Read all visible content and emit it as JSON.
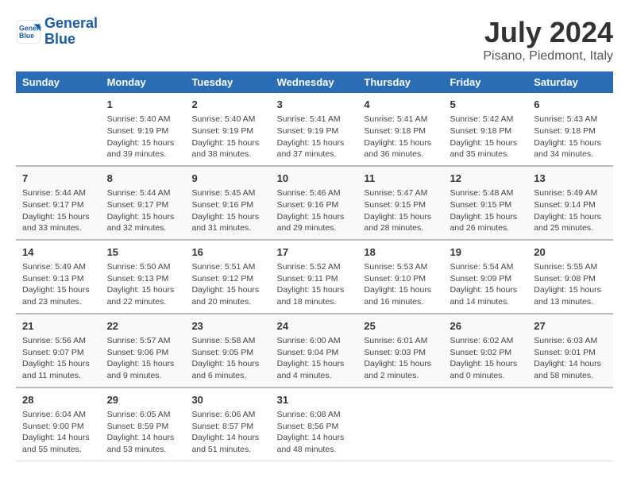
{
  "header": {
    "logo_line1": "General",
    "logo_line2": "Blue",
    "month_year": "July 2024",
    "location": "Pisano, Piedmont, Italy"
  },
  "columns": [
    "Sunday",
    "Monday",
    "Tuesday",
    "Wednesday",
    "Thursday",
    "Friday",
    "Saturday"
  ],
  "weeks": [
    [
      {
        "day": "",
        "info": ""
      },
      {
        "day": "1",
        "info": "Sunrise: 5:40 AM\nSunset: 9:19 PM\nDaylight: 15 hours\nand 39 minutes."
      },
      {
        "day": "2",
        "info": "Sunrise: 5:40 AM\nSunset: 9:19 PM\nDaylight: 15 hours\nand 38 minutes."
      },
      {
        "day": "3",
        "info": "Sunrise: 5:41 AM\nSunset: 9:19 PM\nDaylight: 15 hours\nand 37 minutes."
      },
      {
        "day": "4",
        "info": "Sunrise: 5:41 AM\nSunset: 9:18 PM\nDaylight: 15 hours\nand 36 minutes."
      },
      {
        "day": "5",
        "info": "Sunrise: 5:42 AM\nSunset: 9:18 PM\nDaylight: 15 hours\nand 35 minutes."
      },
      {
        "day": "6",
        "info": "Sunrise: 5:43 AM\nSunset: 9:18 PM\nDaylight: 15 hours\nand 34 minutes."
      }
    ],
    [
      {
        "day": "7",
        "info": "Sunrise: 5:44 AM\nSunset: 9:17 PM\nDaylight: 15 hours\nand 33 minutes."
      },
      {
        "day": "8",
        "info": "Sunrise: 5:44 AM\nSunset: 9:17 PM\nDaylight: 15 hours\nand 32 minutes."
      },
      {
        "day": "9",
        "info": "Sunrise: 5:45 AM\nSunset: 9:16 PM\nDaylight: 15 hours\nand 31 minutes."
      },
      {
        "day": "10",
        "info": "Sunrise: 5:46 AM\nSunset: 9:16 PM\nDaylight: 15 hours\nand 29 minutes."
      },
      {
        "day": "11",
        "info": "Sunrise: 5:47 AM\nSunset: 9:15 PM\nDaylight: 15 hours\nand 28 minutes."
      },
      {
        "day": "12",
        "info": "Sunrise: 5:48 AM\nSunset: 9:15 PM\nDaylight: 15 hours\nand 26 minutes."
      },
      {
        "day": "13",
        "info": "Sunrise: 5:49 AM\nSunset: 9:14 PM\nDaylight: 15 hours\nand 25 minutes."
      }
    ],
    [
      {
        "day": "14",
        "info": "Sunrise: 5:49 AM\nSunset: 9:13 PM\nDaylight: 15 hours\nand 23 minutes."
      },
      {
        "day": "15",
        "info": "Sunrise: 5:50 AM\nSunset: 9:13 PM\nDaylight: 15 hours\nand 22 minutes."
      },
      {
        "day": "16",
        "info": "Sunrise: 5:51 AM\nSunset: 9:12 PM\nDaylight: 15 hours\nand 20 minutes."
      },
      {
        "day": "17",
        "info": "Sunrise: 5:52 AM\nSunset: 9:11 PM\nDaylight: 15 hours\nand 18 minutes."
      },
      {
        "day": "18",
        "info": "Sunrise: 5:53 AM\nSunset: 9:10 PM\nDaylight: 15 hours\nand 16 minutes."
      },
      {
        "day": "19",
        "info": "Sunrise: 5:54 AM\nSunset: 9:09 PM\nDaylight: 15 hours\nand 14 minutes."
      },
      {
        "day": "20",
        "info": "Sunrise: 5:55 AM\nSunset: 9:08 PM\nDaylight: 15 hours\nand 13 minutes."
      }
    ],
    [
      {
        "day": "21",
        "info": "Sunrise: 5:56 AM\nSunset: 9:07 PM\nDaylight: 15 hours\nand 11 minutes."
      },
      {
        "day": "22",
        "info": "Sunrise: 5:57 AM\nSunset: 9:06 PM\nDaylight: 15 hours\nand 9 minutes."
      },
      {
        "day": "23",
        "info": "Sunrise: 5:58 AM\nSunset: 9:05 PM\nDaylight: 15 hours\nand 6 minutes."
      },
      {
        "day": "24",
        "info": "Sunrise: 6:00 AM\nSunset: 9:04 PM\nDaylight: 15 hours\nand 4 minutes."
      },
      {
        "day": "25",
        "info": "Sunrise: 6:01 AM\nSunset: 9:03 PM\nDaylight: 15 hours\nand 2 minutes."
      },
      {
        "day": "26",
        "info": "Sunrise: 6:02 AM\nSunset: 9:02 PM\nDaylight: 15 hours\nand 0 minutes."
      },
      {
        "day": "27",
        "info": "Sunrise: 6:03 AM\nSunset: 9:01 PM\nDaylight: 14 hours\nand 58 minutes."
      }
    ],
    [
      {
        "day": "28",
        "info": "Sunrise: 6:04 AM\nSunset: 9:00 PM\nDaylight: 14 hours\nand 55 minutes."
      },
      {
        "day": "29",
        "info": "Sunrise: 6:05 AM\nSunset: 8:59 PM\nDaylight: 14 hours\nand 53 minutes."
      },
      {
        "day": "30",
        "info": "Sunrise: 6:06 AM\nSunset: 8:57 PM\nDaylight: 14 hours\nand 51 minutes."
      },
      {
        "day": "31",
        "info": "Sunrise: 6:08 AM\nSunset: 8:56 PM\nDaylight: 14 hours\nand 48 minutes."
      },
      {
        "day": "",
        "info": ""
      },
      {
        "day": "",
        "info": ""
      },
      {
        "day": "",
        "info": ""
      }
    ]
  ]
}
